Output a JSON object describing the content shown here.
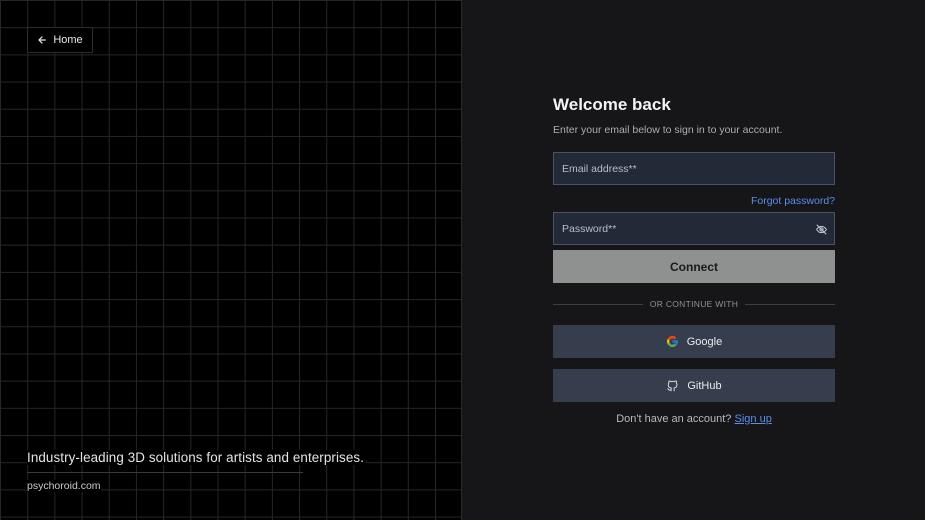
{
  "left": {
    "home_label": "Home",
    "tagline": "Industry-leading 3D solutions for artists and enterprises.",
    "domain": "psychoroid.com"
  },
  "form": {
    "title": "Welcome back",
    "subtitle": "Enter your email below to sign in to your account.",
    "email_placeholder": "Email address**",
    "forgot_label": "Forgot password?",
    "password_placeholder": "Password**",
    "connect_label": "Connect",
    "divider_label": "OR CONTINUE WITH",
    "google_label": "Google",
    "github_label": "GitHub",
    "signup_prompt": "Don't have an account?",
    "signup_label": "Sign up"
  },
  "icons": {
    "home": "arrow-left-icon",
    "password_toggle": "eye-off-icon",
    "google": "google-icon",
    "github": "github-icon"
  },
  "colors": {
    "link": "#5a8dee",
    "connect_bg": "#8f9090",
    "oauth_bg": "#363d4c",
    "field_bg": "#232a37"
  }
}
